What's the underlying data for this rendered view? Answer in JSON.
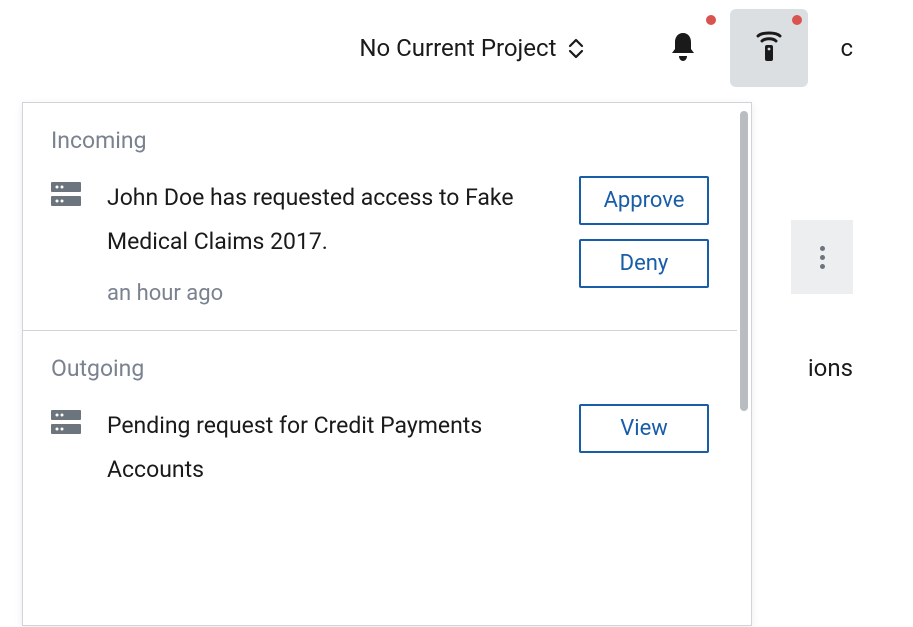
{
  "topbar": {
    "project_selector_label": "No Current Project",
    "avatar_letter": "c"
  },
  "background": {
    "label_fragment": "ions"
  },
  "notifications": {
    "incoming": {
      "title": "Incoming",
      "items": [
        {
          "text": "John Doe has requested access to Fake Medical Claims 2017.",
          "time": "an hour ago",
          "approve_label": "Approve",
          "deny_label": "Deny"
        }
      ]
    },
    "outgoing": {
      "title": "Outgoing",
      "items": [
        {
          "text": "Pending request for Credit Payments Accounts",
          "view_label": "View"
        }
      ]
    }
  }
}
